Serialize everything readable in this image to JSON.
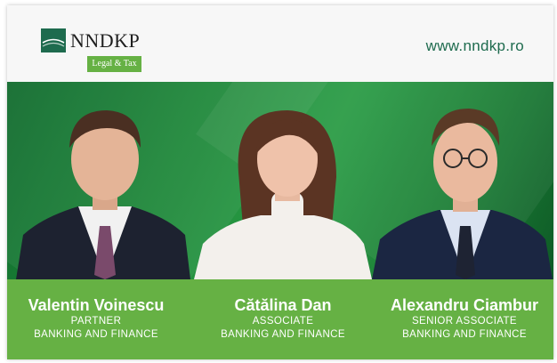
{
  "brand": {
    "name": "NNDKP",
    "tagline": "Legal & Tax",
    "website": "www.nndkp.ro",
    "colors": {
      "dark_green": "#1e6b4e",
      "light_green": "#66b144",
      "bg_green": "#1f8a3b"
    }
  },
  "people": [
    {
      "name": "Valentin Voinescu",
      "role": "PARTNER",
      "practice": "BANKING AND FINANCE"
    },
    {
      "name": "Cătălina Dan",
      "role": "ASSOCIATE",
      "practice": "BANKING AND FINANCE"
    },
    {
      "name": "Alexandru Ciambur",
      "role": "SENIOR ASSOCIATE",
      "practice": "BANKING AND FINANCE"
    }
  ]
}
